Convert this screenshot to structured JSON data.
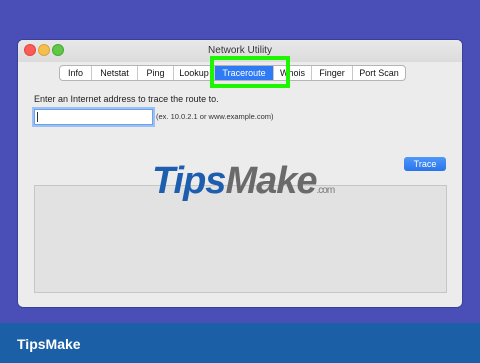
{
  "window": {
    "title": "Network Utility"
  },
  "tabs": [
    {
      "label": "Info",
      "active": false
    },
    {
      "label": "Netstat",
      "active": false
    },
    {
      "label": "Ping",
      "active": false
    },
    {
      "label": "Lookup",
      "active": false
    },
    {
      "label": "Traceroute",
      "active": true
    },
    {
      "label": "Whois",
      "active": false
    },
    {
      "label": "Finger",
      "active": false
    },
    {
      "label": "Port Scan",
      "active": false
    }
  ],
  "traceroute": {
    "prompt": "Enter an Internet address to trace the route to.",
    "address_value": "",
    "example_hint": "(ex. 10.0.2.1 or www.example.com)",
    "trace_button": "Trace",
    "output": ""
  },
  "watermark": {
    "tips": "Tips",
    "make": "Make",
    "suffix": ".com"
  },
  "footer": {
    "brand": "TipsMake"
  },
  "colors": {
    "background": "#4a4fb8",
    "highlight": "#1ef500",
    "accent": "#2e7bf5",
    "footer": "#1b5fa6"
  }
}
